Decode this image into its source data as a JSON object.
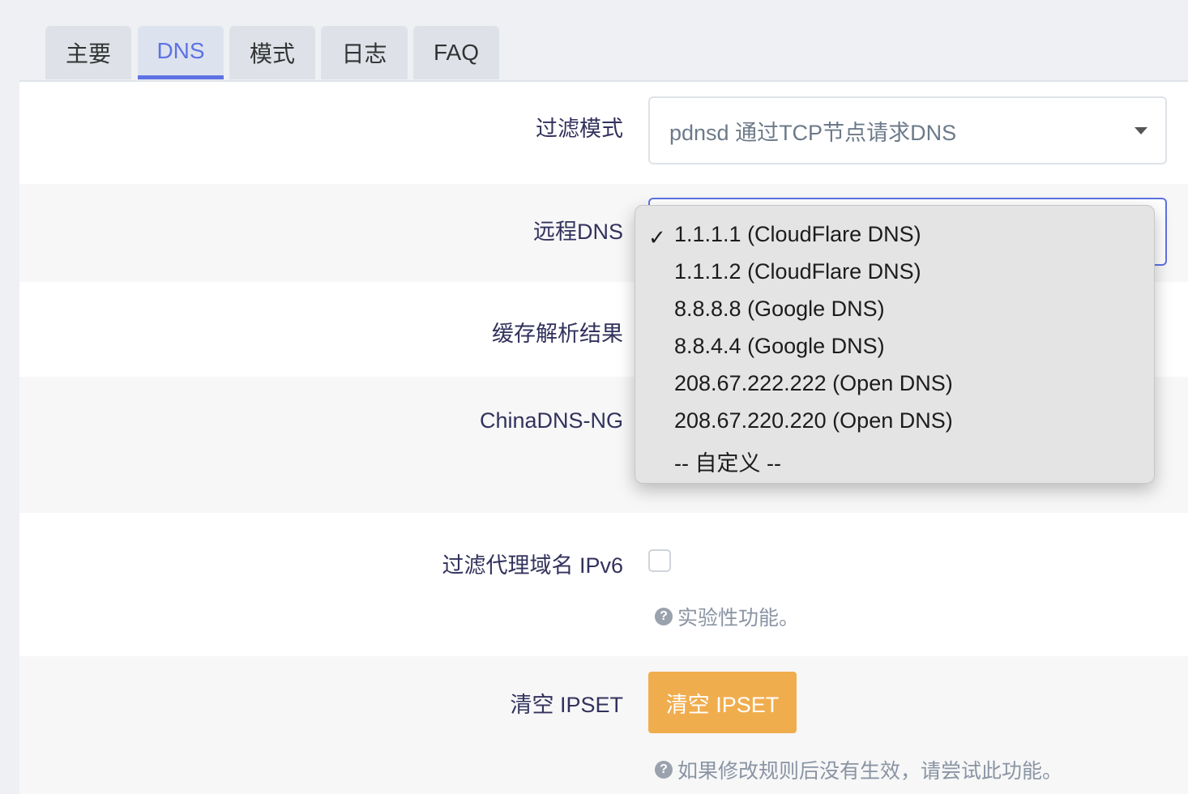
{
  "tabs": [
    {
      "label": "主要"
    },
    {
      "label": "DNS"
    },
    {
      "label": "模式"
    },
    {
      "label": "日志"
    },
    {
      "label": "FAQ"
    }
  ],
  "form": {
    "filter_mode": {
      "label": "过滤模式",
      "value": "pdnsd 通过TCP节点请求DNS"
    },
    "remote_dns": {
      "label": "远程DNS"
    },
    "cache": {
      "label": "缓存解析结果"
    },
    "chinadns": {
      "label": "ChinaDNS-NG"
    },
    "filter_ipv6": {
      "label": "过滤代理域名 IPv6",
      "help": "实验性功能。",
      "checked": false
    },
    "clear_ipset": {
      "label": "清空 IPSET",
      "button": "清空 IPSET",
      "help": "如果修改规则后没有生效，请尝试此功能。"
    }
  },
  "dropdown": {
    "selected_index": 0,
    "options": [
      "1.1.1.1 (CloudFlare DNS)",
      "1.1.1.2 (CloudFlare DNS)",
      "8.8.8.8 (Google DNS)",
      "8.8.4.4 (Google DNS)",
      "208.67.222.222 (Open DNS)",
      "208.67.220.220 (Open DNS)",
      "-- 自定义 --"
    ]
  },
  "icons": {
    "checkmark": "checkmark-icon",
    "help": "help-circle-icon",
    "caret": "caret-down-icon"
  },
  "colors": {
    "accent": "#5e72e4",
    "warning_button": "#f0ad4e"
  }
}
